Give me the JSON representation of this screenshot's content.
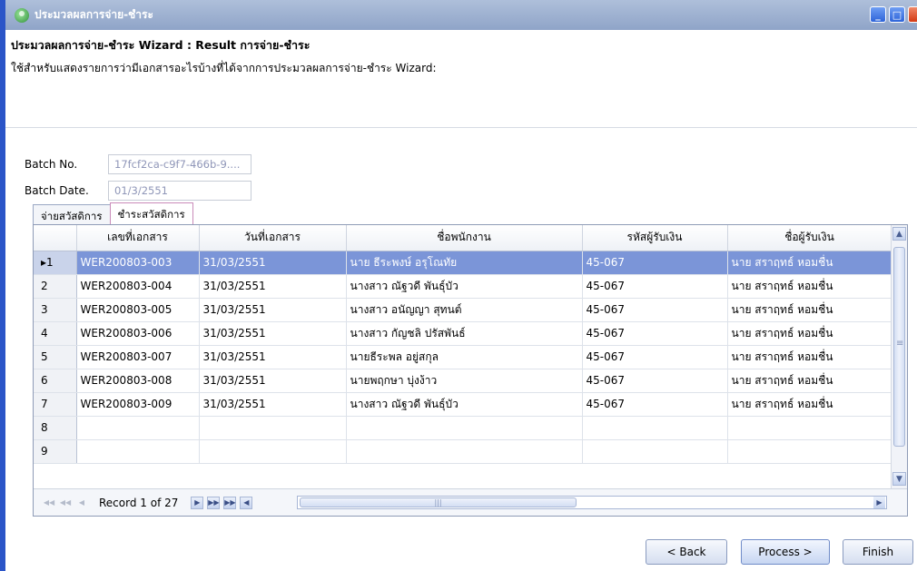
{
  "window": {
    "title": "ประมวลผลการจ่าย-ชำระ"
  },
  "header": {
    "heading": "ประมวลผลการจ่าย-ชำระ Wizard : Result การจ่าย-ชำระ",
    "description": "ใช้สำหรับแสดงรายการว่ามีเอกสารอะไรบ้างที่ได้จากการประมวลผลการจ่าย-ชำระ Wizard:"
  },
  "form": {
    "batch_no_label": "Batch No.",
    "batch_no_value": "17fcf2ca-c9f7-466b-9....",
    "batch_date_label": "Batch Date.",
    "batch_date_value": "01/3/2551"
  },
  "tabs": [
    {
      "label": "จ่ายสวัสดิการ",
      "active": false
    },
    {
      "label": "ชำระสวัสดิการ",
      "active": true
    }
  ],
  "grid": {
    "columns": [
      "",
      "เลขที่เอกสาร",
      "วันที่เอกสาร",
      "ชื่อพนักงาน",
      "รหัสผู้รับเงิน",
      "ชื่อผู้รับเงิน"
    ],
    "rows": [
      {
        "num": "1",
        "doc": "WER200803-003",
        "date": "31/03/2551",
        "emp": "นาย ธีระพงษ์ อรุโณทัย",
        "payee_code": "45-067",
        "payee": "นาย สราฤทธ์ หอมชื่น",
        "selected": true
      },
      {
        "num": "2",
        "doc": "WER200803-004",
        "date": "31/03/2551",
        "emp": "นางสาว ณัฐวดี พันธุ์บัว",
        "payee_code": "45-067",
        "payee": "นาย สราฤทธ์ หอมชื่น"
      },
      {
        "num": "3",
        "doc": "WER200803-005",
        "date": "31/03/2551",
        "emp": "นางสาว อนัญญา สุทนต์",
        "payee_code": "45-067",
        "payee": "นาย สราฤทธ์ หอมชื่น"
      },
      {
        "num": "4",
        "doc": "WER200803-006",
        "date": "31/03/2551",
        "emp": "นางสาว กัญชลิ ปรัสพันธ์",
        "payee_code": "45-067",
        "payee": "นาย สราฤทธ์ หอมชื่น"
      },
      {
        "num": "5",
        "doc": "WER200803-007",
        "date": "31/03/2551",
        "emp": "นายธีระพล อยู่สกุล",
        "payee_code": "45-067",
        "payee": "นาย สราฤทธ์ หอมชื่น"
      },
      {
        "num": "6",
        "doc": "WER200803-008",
        "date": "31/03/2551",
        "emp": "นายพฤกษา บุ่งง้าว",
        "payee_code": "45-067",
        "payee": "นาย สราฤทธ์ หอมชื่น"
      },
      {
        "num": "7",
        "doc": "WER200803-009",
        "date": "31/03/2551",
        "emp": "นางสาว ณัฐวดี พันธุ์บัว",
        "payee_code": "45-067",
        "payee": "นาย สราฤทธ์ หอมชื่น"
      },
      {
        "num": "8",
        "doc": "",
        "date": "",
        "emp": "",
        "payee_code": "",
        "payee": ""
      },
      {
        "num": "9",
        "doc": "",
        "date": "",
        "emp": "",
        "payee_code": "",
        "payee": ""
      }
    ],
    "record_text": "Record 1 of 27"
  },
  "buttons": {
    "back": "< Back",
    "process": "Process >",
    "finish": "Finish"
  },
  "icons": {
    "row_indicator": "▸",
    "nav_first": "first-record-icon",
    "nav_prev_page": "prev-page-icon",
    "nav_prev": "prev-record-icon",
    "nav_next": "next-record-icon",
    "nav_next_page": "next-page-icon",
    "nav_last": "last-record-icon"
  },
  "colors": {
    "titlebar": "#2b55c8",
    "selected_row": "#7b95d8"
  }
}
